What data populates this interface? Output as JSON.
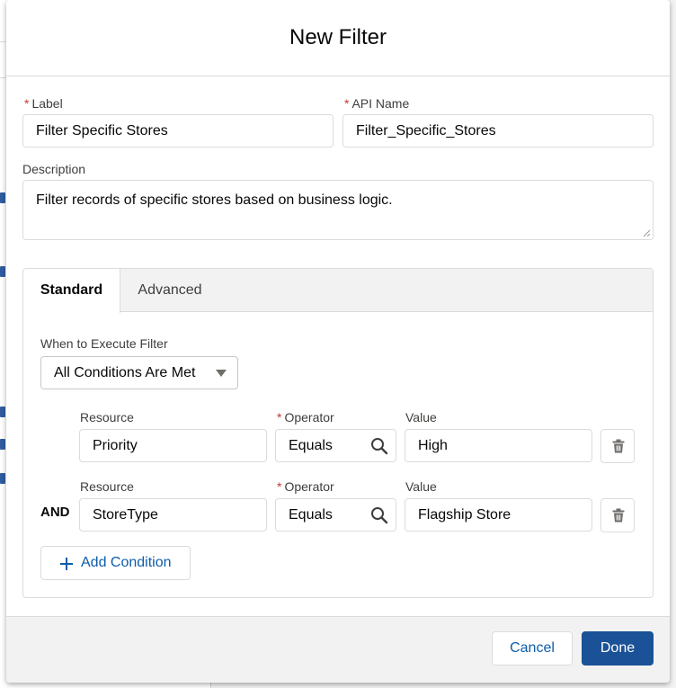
{
  "modal": {
    "title": "New Filter"
  },
  "fields": {
    "label": {
      "required_mark": "*",
      "label": "Label",
      "value": "Filter Specific Stores"
    },
    "api_name": {
      "required_mark": "*",
      "label": "API Name",
      "value": "Filter_Specific_Stores"
    },
    "description": {
      "label": "Description",
      "value": "Filter records of specific stores based on business logic."
    }
  },
  "tabs": [
    {
      "label": "Standard",
      "active": true
    },
    {
      "label": "Advanced",
      "active": false
    }
  ],
  "execute": {
    "label": "When to Execute Filter",
    "selected": "All Conditions Are Met"
  },
  "conditions": [
    {
      "connector": "",
      "resource_label": "Resource",
      "resource_value": "Priority",
      "operator_required_mark": "*",
      "operator_label": "Operator",
      "operator_value": "Equals",
      "value_label": "Value",
      "value_value": "High"
    },
    {
      "connector": "AND",
      "resource_label": "Resource",
      "resource_value": "StoreType",
      "operator_required_mark": "*",
      "operator_label": "Operator",
      "operator_value": "Equals",
      "value_label": "Value",
      "value_value": "Flagship Store"
    }
  ],
  "add_condition_label": "Add Condition",
  "footer": {
    "cancel_label": "Cancel",
    "done_label": "Done"
  },
  "colors": {
    "brand": "#1b5297",
    "link": "#0b5cab",
    "required": "#c23934",
    "border": "#dddbda"
  },
  "icons": {
    "operator_lookup": "search-icon",
    "delete_condition": "trash-icon",
    "add": "plus-icon",
    "select": "chevron-down-icon"
  }
}
